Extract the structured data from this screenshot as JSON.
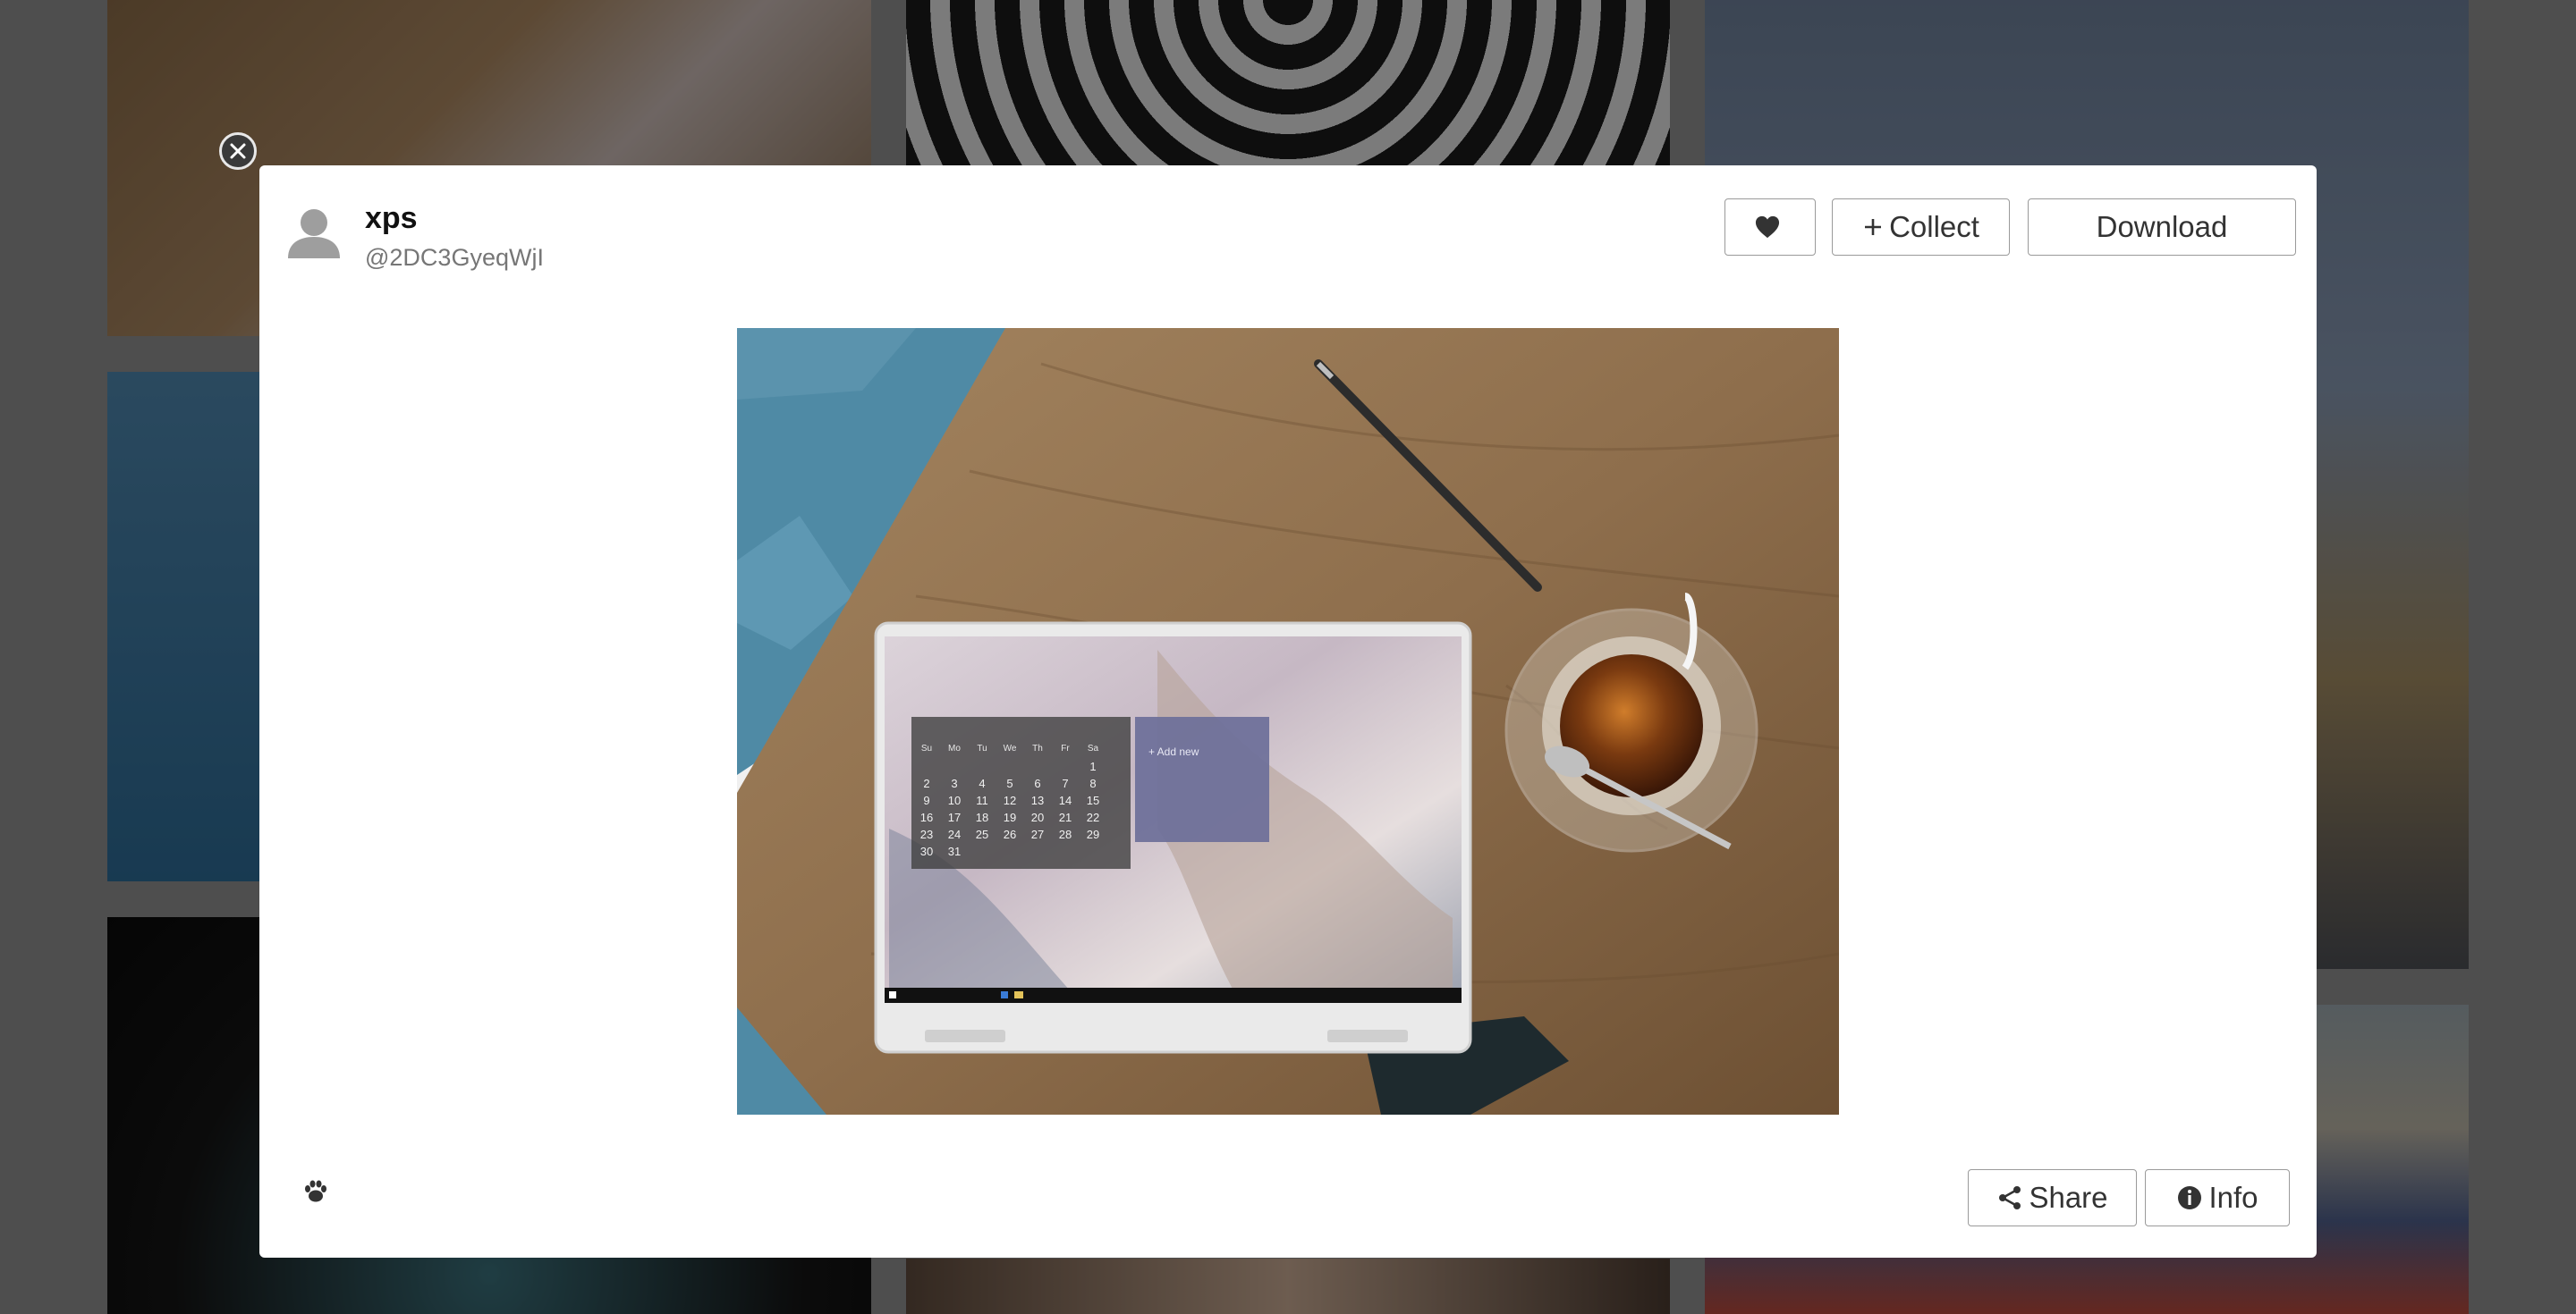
{
  "modal": {
    "user": {
      "name": "xps",
      "handle": "@2DC3GyeqWjI"
    },
    "actions": {
      "collect_label": "Collect",
      "download_label": "Download"
    },
    "footer": {
      "share_label": "Share",
      "info_label": "Info"
    }
  },
  "photo": {
    "screen": {
      "weekdays": [
        "Su",
        "Mo",
        "Tu",
        "We",
        "Th",
        "Fr",
        "Sa"
      ],
      "dates": [
        "1",
        "2",
        "3",
        "4",
        "5",
        "6",
        "7",
        "8",
        "9",
        "10",
        "11",
        "12",
        "13",
        "14",
        "15",
        "16",
        "17",
        "18",
        "19",
        "20",
        "21",
        "22",
        "23",
        "24",
        "25",
        "26",
        "27",
        "28",
        "29",
        "30",
        "31"
      ],
      "note_label": "+ Add new"
    }
  },
  "icons": {
    "close": "close-icon",
    "like": "heart-icon",
    "collect": "plus-icon",
    "share": "share-icon",
    "info": "info-icon",
    "paw": "paw-icon",
    "avatar": "user-silhouette-icon"
  }
}
